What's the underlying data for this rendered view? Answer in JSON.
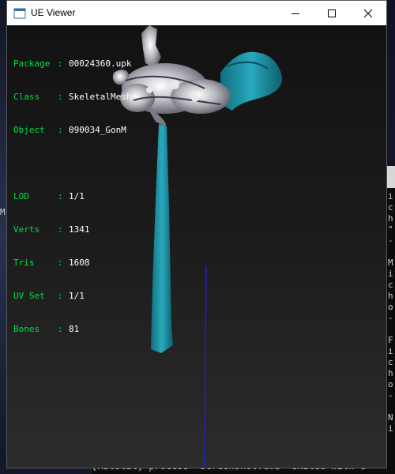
{
  "window": {
    "title": "UE Viewer",
    "buttons": {
      "minimize": "minimize-icon",
      "maximize": "maximize-icon",
      "close": "close-icon"
    }
  },
  "overlay": {
    "package": {
      "label": "Package",
      "value": "00024360.upk"
    },
    "class": {
      "label": "Class",
      "value": "SkeletalMesh"
    },
    "object": {
      "label": "Object",
      "value": "090034_GonM"
    },
    "lod": {
      "label": "LOD",
      "value": "1/1"
    },
    "verts": {
      "label": "Verts",
      "value": "1341"
    },
    "tris": {
      "label": "Tris",
      "value": "1608"
    },
    "uvset": {
      "label": "UV Set",
      "value": "1/1"
    },
    "bones": {
      "label": "Bones",
      "value": "81"
    }
  },
  "background": {
    "left_letter": "M",
    "console_lines": [
      "i",
      "c",
      "h",
      "\"",
      "-",
      "",
      "M",
      "i",
      "c",
      "h",
      "o",
      "-",
      "",
      "F",
      "i",
      "c",
      "h",
      "o",
      "-",
      "",
      "N",
      "i"
    ],
    "console_bottom": "[RstUtil] process \"screenshot.cmd\" exited with c"
  },
  "colors": {
    "overlay_label": "#00e040",
    "overlay_value": "#ffffff",
    "cloth": "#1a8fa4",
    "bone_line": "#2020c0"
  }
}
